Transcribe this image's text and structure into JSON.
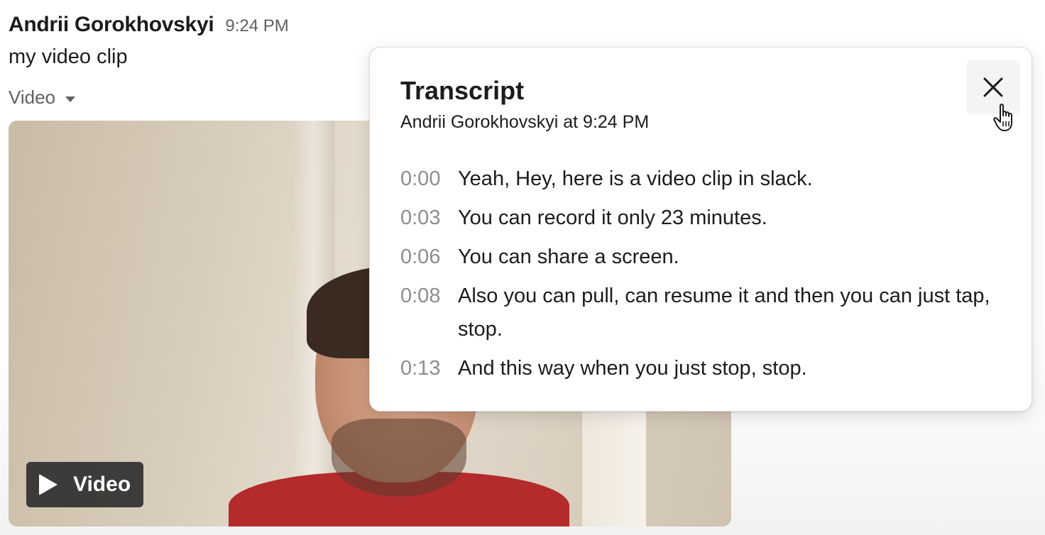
{
  "message": {
    "author": "Andrii Gorokhovskyi",
    "time": "9:24 PM",
    "text": "my video clip",
    "attachment_label": "Video"
  },
  "video": {
    "badge_label": "Video"
  },
  "transcript": {
    "title": "Transcript",
    "subtitle": "Andrii Gorokhovskyi at 9:24 PM",
    "lines": [
      {
        "time": "0:00",
        "text": "Yeah, Hey, here is a video clip in slack."
      },
      {
        "time": "0:03",
        "text": "You can record it only 23 minutes."
      },
      {
        "time": "0:06",
        "text": "You can share a screen."
      },
      {
        "time": "0:08",
        "text": "Also you can pull, can resume it and then you can just tap, stop."
      },
      {
        "time": "0:13",
        "text": "And this way when you just stop, stop."
      }
    ]
  },
  "icons": {
    "close": "close-icon",
    "cursor": "hand-pointer-icon",
    "play": "play-icon",
    "caret": "chevron-down-icon"
  }
}
